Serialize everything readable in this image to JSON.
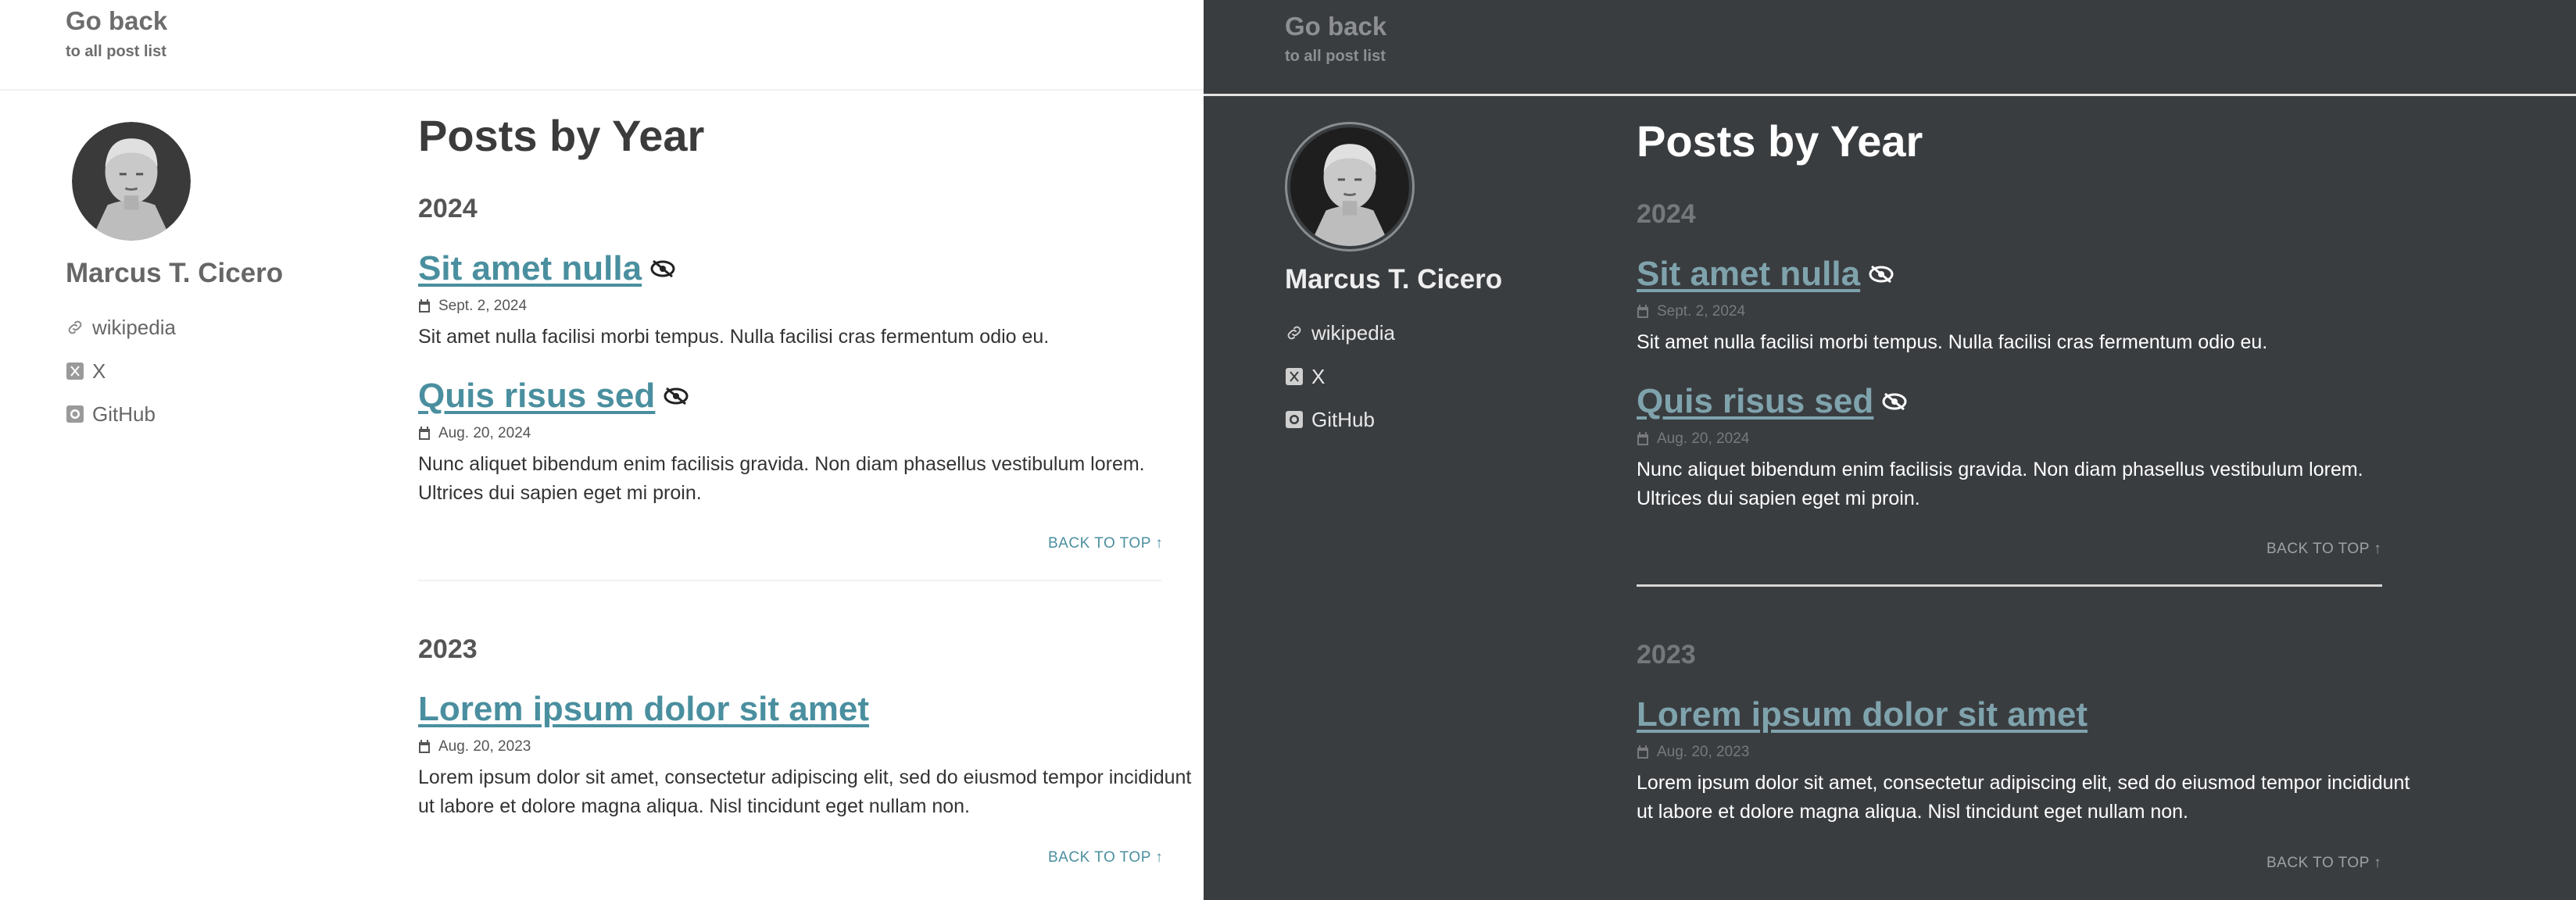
{
  "header": {
    "go_back": "Go back",
    "sub": "to all post list"
  },
  "sidebar": {
    "author": "Marcus T. Cicero",
    "links": [
      {
        "label": "wikipedia",
        "icon": "link-icon"
      },
      {
        "label": "X",
        "icon": "x-icon"
      },
      {
        "label": "GitHub",
        "icon": "github-icon"
      }
    ]
  },
  "main": {
    "title": "Posts by Year",
    "years": [
      {
        "year": "2024",
        "posts": [
          {
            "title": "Sit amet nulla",
            "hidden_icon": "eye-slash-icon",
            "date": "Sept. 2, 2024",
            "excerpt": "Sit amet nulla facilisi morbi tempus. Nulla facilisi cras fermentum odio eu."
          },
          {
            "title": "Quis risus sed",
            "hidden_icon": "eye-slash-icon",
            "date": "Aug. 20, 2024",
            "excerpt": "Nunc aliquet bibendum enim facilisis gravida. Non diam phasellus vestibulum lorem. Ultrices dui sapien eget mi proin."
          }
        ],
        "back_to_top": "BACK TO TOP ↑"
      },
      {
        "year": "2023",
        "posts": [
          {
            "title": "Lorem ipsum dolor sit amet",
            "date": "Aug. 20, 2023",
            "excerpt": "Lorem ipsum dolor sit amet, consectetur adipiscing elit, sed do eiusmod tempor incididunt ut labore et dolore magna aliqua. Nisl tincidunt eget nullam non."
          }
        ],
        "back_to_top": "BACK TO TOP ↑"
      }
    ]
  },
  "themes": {
    "light": {
      "background": "#ffffff",
      "link": "#4a8f9f"
    },
    "dark": {
      "background": "#3a3d40",
      "link": "#7fa3ad"
    }
  }
}
